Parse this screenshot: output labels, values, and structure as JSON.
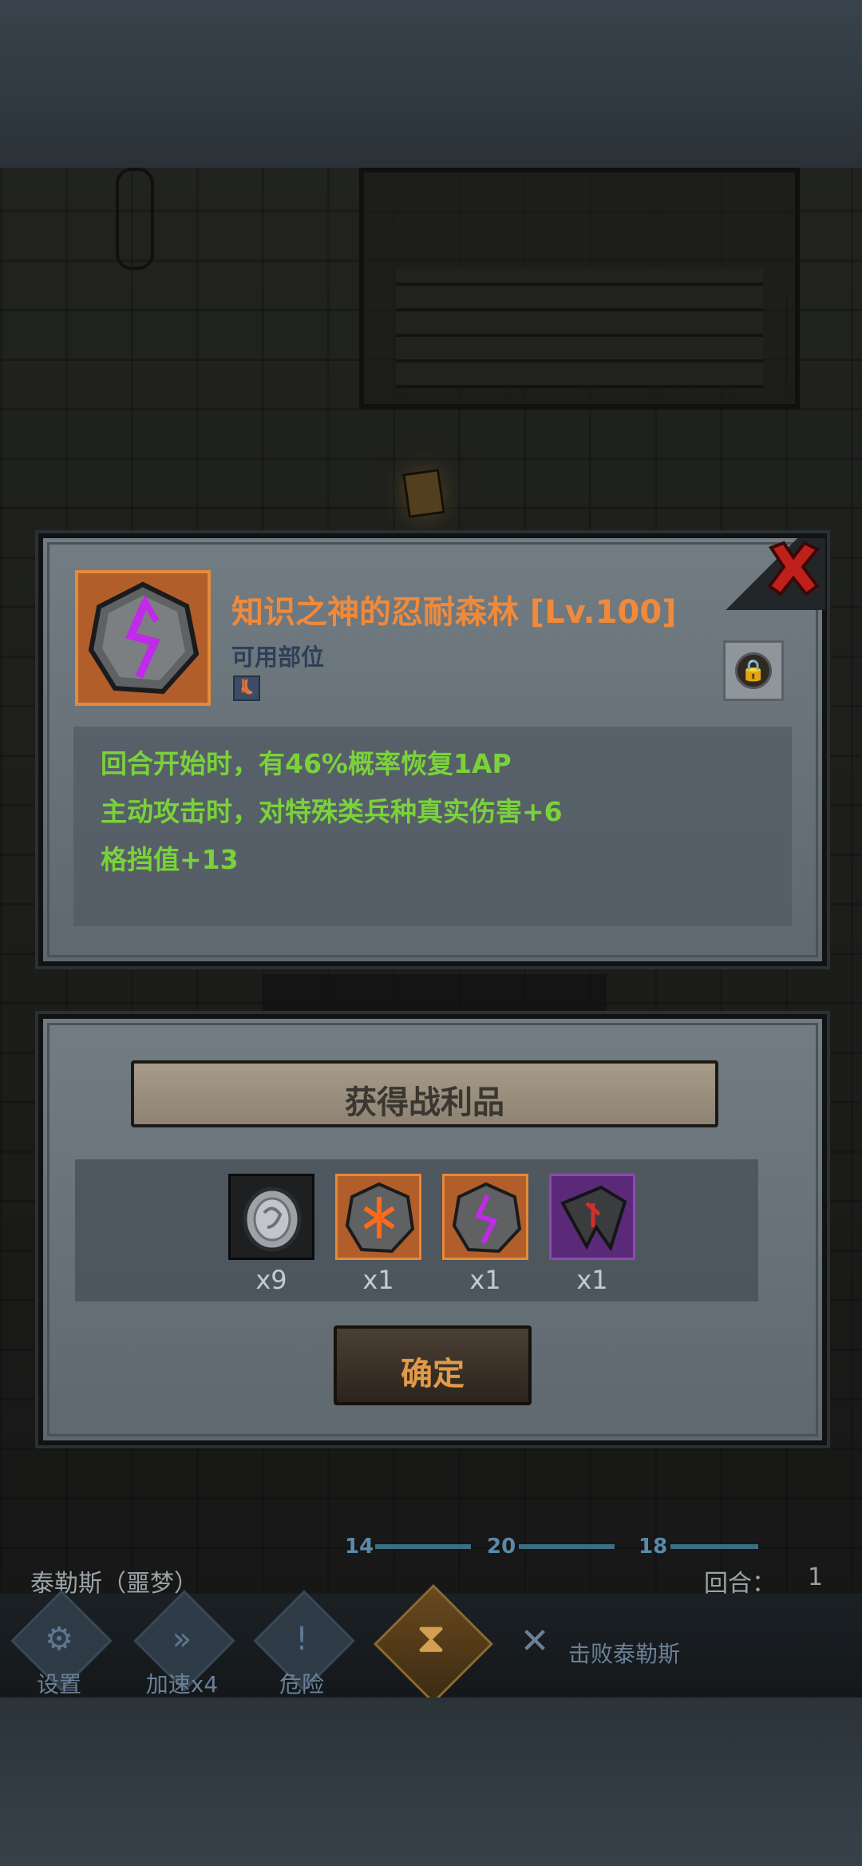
{
  "item": {
    "name": "知识之神的忍耐森林 [Lv.100]",
    "slot_label": "可用部位",
    "slot_icon": "boots-icon",
    "stats": [
      "回合开始时，有46%概率恢复1AP",
      "主动攻击时，对特殊类兵种真实伤害+6",
      "格挡值+13"
    ]
  },
  "loot": {
    "title": "获得战利品",
    "items": [
      {
        "icon": "silver-coin-icon",
        "count": "x9",
        "frame": "#1e1f20"
      },
      {
        "icon": "orange-rune-stone-icon",
        "count": "x1",
        "frame": "#b15e2a"
      },
      {
        "icon": "purple-rune-stone-icon",
        "count": "x1",
        "frame": "#b15e2a"
      },
      {
        "icon": "dark-shard-icon",
        "count": "x1",
        "frame": "#5a2a78"
      }
    ],
    "confirm_label": "确定"
  },
  "hud": {
    "boss_name": "泰勒斯（噩梦）",
    "round_label": "回合：",
    "round_value": "1",
    "hp_values": [
      "14",
      "20",
      "18"
    ],
    "buttons": [
      {
        "label": "设置",
        "icon": "gear-icon"
      },
      {
        "label": "加速x4",
        "icon": "fast-forward-icon"
      },
      {
        "label": "危险",
        "icon": "exclamation-icon"
      }
    ],
    "objective": "击败泰勒斯"
  },
  "colors": {
    "stat_green": "#7ad23a",
    "title_orange": "#f08a3a",
    "rarity_orange": "#b15e2a",
    "rarity_purple": "#5a2a78"
  }
}
